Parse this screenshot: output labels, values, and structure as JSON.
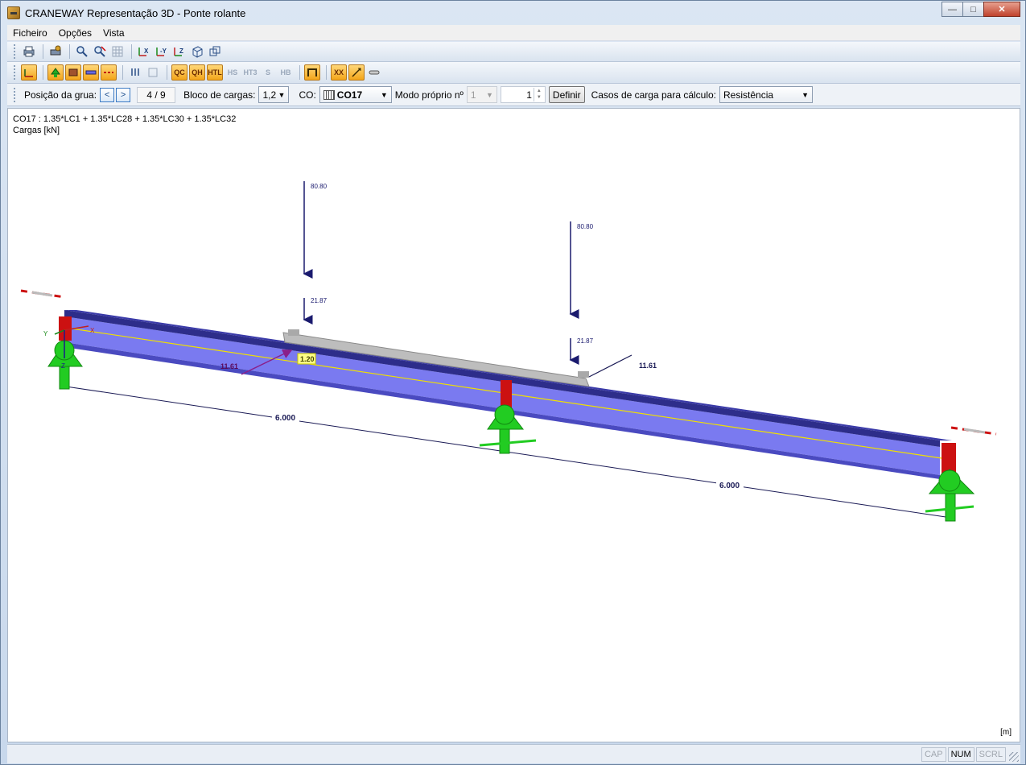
{
  "window": {
    "title": "CRANEWAY Representação 3D - Ponte rolante",
    "minimize": "—",
    "maximize": "□",
    "close": "✕"
  },
  "menu": {
    "items": [
      "Ficheiro",
      "Opções",
      "Vista"
    ]
  },
  "toolbar1": {
    "buttons": [
      "print-icon",
      "print-settings-icon",
      "zoom-icon",
      "zoom-out-icon",
      "grid-icon",
      "view-x-icon",
      "view-minus-y-icon",
      "view-z-icon",
      "iso-view-icon",
      "wire-view-icon"
    ],
    "labels": {
      "view_x": "X",
      "view_y": "-Y",
      "view_z": "Z"
    }
  },
  "toolbar2": {
    "labels": {
      "qc": "QC",
      "qh": "QH",
      "htl": "HTL",
      "hs": "HS",
      "ht3": "HT3",
      "s": "S",
      "hb": "HB",
      "lxx": "XX"
    }
  },
  "controls": {
    "crane_position_label": "Posição da grua:",
    "prev": "<",
    "next": ">",
    "position_value": "4 / 9",
    "load_block_label": "Bloco de cargas:",
    "load_block_value": "1,2",
    "co_label": "CO:",
    "co_value": "CO17",
    "mode_label": "Modo próprio nº",
    "mode_value": "1",
    "mode_spin_value": "1",
    "define_button": "Definir",
    "load_cases_label": "Casos de carga para cálculo:",
    "load_cases_value": "Resistência"
  },
  "viewport": {
    "combination": "CO17 : 1.35*LC1 + 1.35*LC28 + 1.35*LC30 + 1.35*LC32",
    "loads_caption": "Cargas [kN]",
    "unit": "[m]",
    "load_labels": {
      "v1": "80.80",
      "v2": "80.80",
      "h1": "21.87",
      "h2": "21.87",
      "lat1": "11.61",
      "lat2": "11.61",
      "axial": "1.20"
    },
    "dims": [
      "6.000",
      "6.000"
    ],
    "axes": {
      "x": "X",
      "y": "Y",
      "z": "Z"
    },
    "colors": {
      "beam_top": "#3a3aa8",
      "beam_side": "#7a7af0",
      "support": "#22cc22",
      "end_plate": "#cc1111",
      "load_arrow": "#1a1a6e",
      "centroid_line": "#f0e000"
    }
  },
  "status": {
    "cap": "CAP",
    "num": "NUM",
    "scrl": "SCRL"
  }
}
